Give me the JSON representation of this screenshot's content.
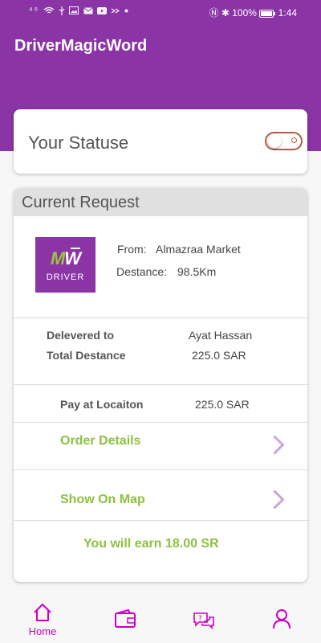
{
  "status_bar": {
    "signal": "⁴⁶",
    "battery": "100%",
    "time": "1:44"
  },
  "app": {
    "title": "DriverMagicWord"
  },
  "status_card": {
    "label": "Your Statuse",
    "toggle_on": false
  },
  "request": {
    "title": "Current Request",
    "logo": {
      "letters": "MW",
      "caption": "DRIVER"
    },
    "from_label": "From:",
    "from_value": "Almazraa Market",
    "distance_label": "Destance:",
    "distance_value": "98.5Km",
    "delivered_label": "Delevered to",
    "delivered_value": "Ayat Hassan",
    "total_label": "Total Destance",
    "total_value": "225.0 SAR",
    "pay_label": "Pay at Locaiton",
    "pay_value": "225.0 SAR",
    "order_details": "Order Details",
    "show_map": "Show On Map",
    "earn": "You will earn 18.00 SR"
  },
  "nav": {
    "home": "Home"
  },
  "colors": {
    "primary": "#8a34a6",
    "accent_green": "#8dc13f",
    "nav_active": "#c800c8"
  }
}
